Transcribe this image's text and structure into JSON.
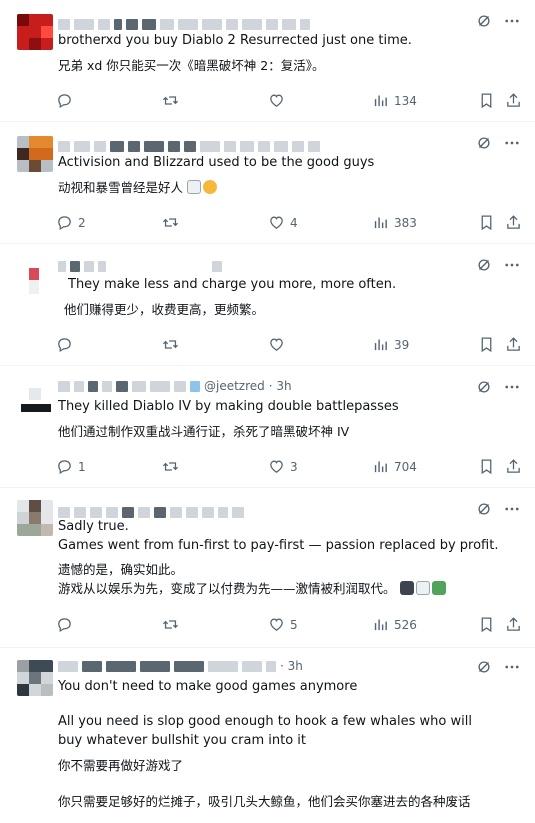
{
  "tweets": [
    {
      "handle": "",
      "time": "",
      "text_en": "brotherxd you buy Diablo 2 Resurrected just one time.",
      "text_zh": "兄弟 xd 你只能买一次《暗黑破坏神 2：复活》。",
      "replies": "",
      "reposts": "",
      "likes": "",
      "views": "134"
    },
    {
      "handle": "",
      "time": "",
      "text_en": "Activision and Blizzard used to be the good guys",
      "text_zh": "动视和暴雪曾经是好人",
      "replies": "2",
      "reposts": "",
      "likes": "4",
      "views": "383"
    },
    {
      "handle": "",
      "time": "",
      "text_en": "They make less and charge you more, more often.",
      "text_zh": "他们赚得更少，收费更高，更频繁。",
      "replies": "",
      "reposts": "",
      "likes": "",
      "views": "39"
    },
    {
      "handle": "@jeetzred",
      "time": "· 3h",
      "text_en": "They killed Diablo IV by making double battlepasses",
      "text_zh": "他们通过制作双重战斗通行证，杀死了暗黑破坏神 IV",
      "replies": "1",
      "reposts": "",
      "likes": "3",
      "views": "704"
    },
    {
      "handle": "",
      "time": "",
      "text_en": "Sadly true.\nGames went from fun-first to pay-first — passion replaced by profit.",
      "text_zh": "遗憾的是，确实如此。\n游戏从以娱乐为先，变成了以付费为先——激情被利润取代。",
      "replies": "",
      "reposts": "",
      "likes": "5",
      "views": "526"
    },
    {
      "handle": "",
      "time": "· 3h",
      "text_en": "You don't need to make good games anymore",
      "text_en2": "All you need is slop good enough to hook a few whales who will buy whatever bullshit you cram into it",
      "text_zh": "你不需要再做好游戏了",
      "text_zh2": "你只需要足够好的烂摊子，吸引几头大鲸鱼，他们会买你塞进去的各种废话"
    }
  ]
}
